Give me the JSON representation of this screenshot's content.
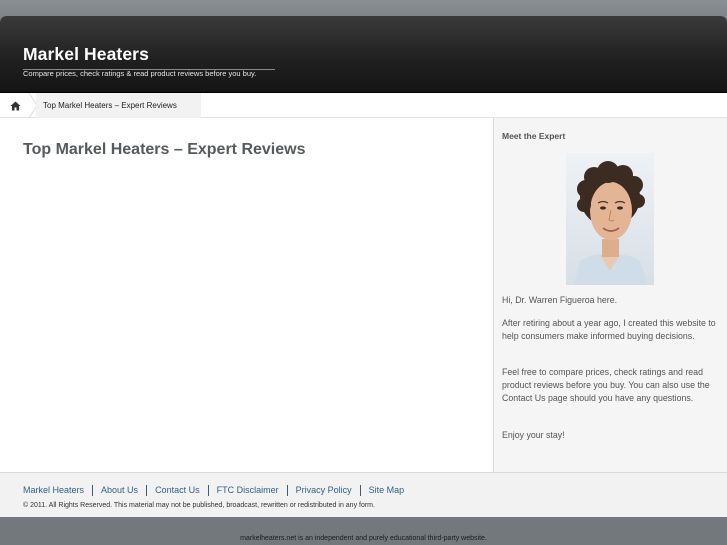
{
  "header": {
    "title": "Markel Heaters",
    "tagline": "Compare prices, check ratings & read product reviews before you buy."
  },
  "breadcrumb": {
    "home_icon": "home-icon",
    "current": "Top Markel Heaters – Expert Reviews"
  },
  "main": {
    "title": "Top Markel Heaters – Expert Reviews"
  },
  "sidebar": {
    "heading": "Meet the Expert",
    "intro": "Hi, Dr. Warren Figueroa here.",
    "para1": "After retiring about a year ago, I created this website to help consumers make informed buying decisions.",
    "para2": "Feel free to compare prices, check ratings and read product reviews before you buy. You can also use the Contact Us page should you have any questions.",
    "para3": "Enjoy your stay!"
  },
  "footer": {
    "links": [
      "Markel Heaters",
      "About Us",
      "Contact Us",
      "FTC Disclaimer",
      "Privacy Policy",
      "Site Map"
    ],
    "copyright": "© 2011. All Rights Reserved. This material may not be published, broadcast, rewritten or redistributed in any form."
  },
  "disclaimer": "markelheaters.net is an independent and purely educational third-party website.",
  "colors": {
    "link": "#2f5f8c",
    "header_bg": "#1f1f1f",
    "title_text": "#555a5f"
  }
}
